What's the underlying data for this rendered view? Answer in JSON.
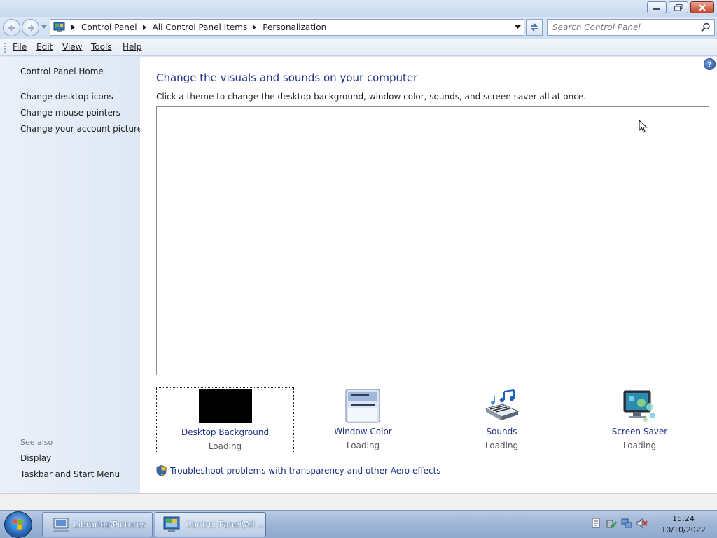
{
  "window": {
    "caption_buttons": [
      "minimize-icon",
      "restore-icon",
      "close-icon"
    ]
  },
  "address_bar": {
    "crumbs": [
      "Control Panel",
      "All Control Panel Items",
      "Personalization"
    ],
    "search_placeholder": "Search Control Panel"
  },
  "menu": {
    "file": "File",
    "edit": "Edit",
    "view": "View",
    "tools": "Tools",
    "help": "Help"
  },
  "left_pane": {
    "home": "Control Panel Home",
    "links": [
      "Change desktop icons",
      "Change mouse pointers",
      "Change your account picture"
    ],
    "see_also_label": "See also",
    "see_also": [
      "Display",
      "Taskbar and Start Menu"
    ]
  },
  "main": {
    "heading": "Change the visuals and sounds on your computer",
    "subtext": "Click a theme to change the desktop background, window color, sounds, and screen saver all at once.",
    "tiles": [
      {
        "title": "Desktop Background",
        "status": "Loading"
      },
      {
        "title": "Window Color",
        "status": "Loading"
      },
      {
        "title": "Sounds",
        "status": "Loading"
      },
      {
        "title": "Screen Saver",
        "status": "Loading"
      }
    ],
    "aero_link": "Troubleshoot problems with transparency and other Aero effects"
  },
  "taskbar": {
    "buttons": [
      "Libraries\\Pictures",
      "Control Panel\\All ..."
    ],
    "clock_time": "15:24",
    "clock_date": "10/10/2022"
  },
  "colors": {
    "link_blue": "#1e3287",
    "heading_blue": "#1e3287"
  }
}
